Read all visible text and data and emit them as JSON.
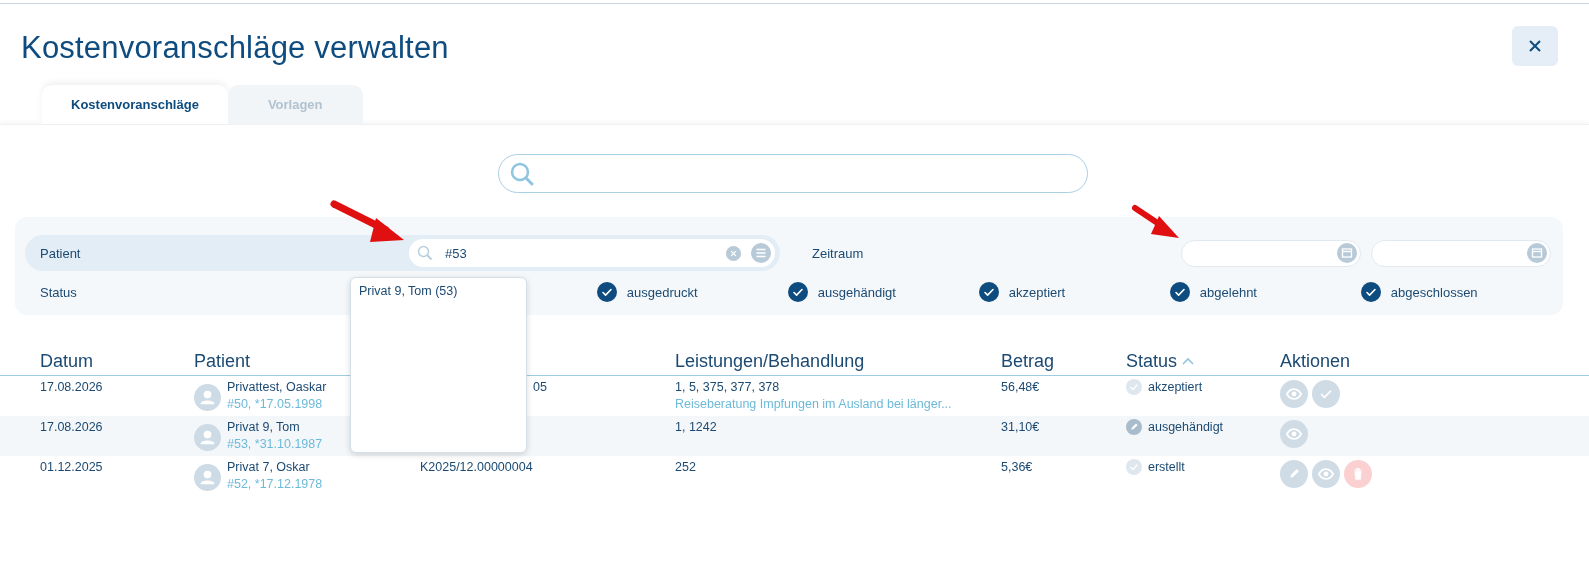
{
  "title": "Kostenvoranschläge verwalten",
  "tabs": [
    {
      "label": "Kostenvoranschläge",
      "selected": true
    },
    {
      "label": "Vorlagen",
      "selected": false
    }
  ],
  "filters": {
    "patient": {
      "label": "Patient",
      "value": "#53"
    },
    "period": {
      "label": "Zeitraum"
    },
    "status": {
      "label": "Status",
      "options": [
        {
          "label": "ausgedruckt",
          "checked": true
        },
        {
          "label": "ausgehändigt",
          "checked": true
        },
        {
          "label": "akzeptiert",
          "checked": true
        },
        {
          "label": "abgelehnt",
          "checked": true
        },
        {
          "label": "abgeschlossen",
          "checked": true
        }
      ]
    }
  },
  "suggestions": [
    "Privat 9, Tom (53)"
  ],
  "table": {
    "columns": [
      {
        "label": "Datum"
      },
      {
        "label": "Patient"
      },
      {},
      {
        "label": "Leistungen/Behandlung"
      },
      {
        "label": "Betrag"
      },
      {
        "label": "Status",
        "sorted": true
      },
      {
        "label": "Aktionen"
      }
    ],
    "rows": [
      {
        "date": "17.08.2026",
        "patient": "Privattest, Oaskar",
        "patient_info": "#50, *17.05.1998",
        "column_3": "05",
        "services": "1, 5, 375, 377, 378",
        "description": "Reiseberatung Impfungen im Ausland bei länger...",
        "amount": "56,48€",
        "status": {
          "label": "akzeptiert",
          "kind": "check"
        },
        "actions": [
          {
            "kind": "view"
          },
          {
            "kind": "accept"
          }
        ]
      },
      {
        "date": "17.08.2026",
        "patient": "Privat 9, Tom",
        "patient_info": "#53, *31.10.1987",
        "services": "1, 1242",
        "amount": "31,10€",
        "status": {
          "label": "ausgehändigt",
          "kind": "pencil"
        },
        "actions": [
          {
            "kind": "view"
          }
        ]
      },
      {
        "date": "01.12.2025",
        "patient": "Privat 7, Oskar",
        "patient_info": "#52, *17.12.1978",
        "column_3": "K2025/12.00000004",
        "services": "252",
        "amount": "5,36€",
        "status": {
          "label": "erstellt",
          "kind": "check"
        },
        "actions": [
          {
            "kind": "edit"
          },
          {
            "kind": "view"
          },
          {
            "kind": "delete"
          }
        ]
      }
    ]
  }
}
